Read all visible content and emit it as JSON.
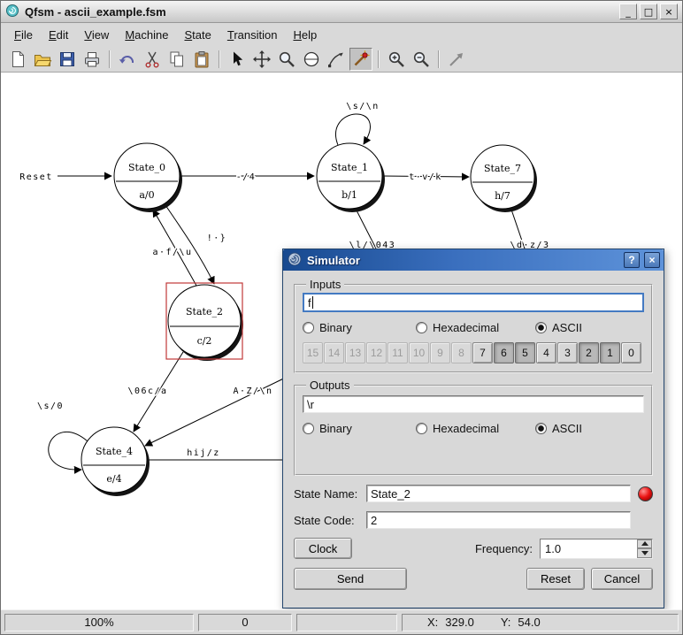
{
  "window": {
    "title": "Qfsm - ascii_example.fsm",
    "controls": {
      "minimize": "_",
      "maximize": "□",
      "close": "×"
    }
  },
  "menu": {
    "items": [
      "File",
      "Edit",
      "View",
      "Machine",
      "State",
      "Transition",
      "Help"
    ]
  },
  "toolbar": {
    "tools": [
      "new-file",
      "open-file",
      "save-file",
      "print",
      "undo",
      "cut",
      "copy",
      "paste",
      "select",
      "move",
      "zoom",
      "add-state",
      "add-transition",
      "simulate",
      "zoom-in",
      "zoom-out",
      "pan"
    ],
    "active_tool": "simulate"
  },
  "canvas": {
    "states": [
      {
        "name": "State_0",
        "code": "a/0"
      },
      {
        "name": "State_1",
        "code": "b/1"
      },
      {
        "name": "State_7",
        "code": "h/7"
      },
      {
        "name": "State_2",
        "code": "c/2",
        "selected": true
      },
      {
        "name": "State_4",
        "code": "e/4"
      }
    ],
    "transitions": {
      "reset": "Reset",
      "t0_t1": "-/4",
      "t1_self": "\\s/\\n",
      "t1_t7": "t·v/k",
      "t0_t2": "!·}",
      "t2_t0": "a·f/\\u",
      "t1_down": "\\l/\\043",
      "t7_down": "\\d·z/3",
      "t2_t4": "\\06c/a",
      "az_t4": "A·Z/\\n",
      "t4_self": "\\s/0",
      "t4_right": "hij/z"
    }
  },
  "simulator": {
    "title": "Simulator",
    "help_glyph": "?",
    "close_glyph": "×",
    "inputs": {
      "legend": "Inputs",
      "value": "f",
      "modes": [
        "Binary",
        "Hexadecimal",
        "ASCII"
      ],
      "selected_mode": "ASCII",
      "bits": [
        {
          "label": "15",
          "state": "disabled"
        },
        {
          "label": "14",
          "state": "disabled"
        },
        {
          "label": "13",
          "state": "disabled"
        },
        {
          "label": "12",
          "state": "disabled"
        },
        {
          "label": "11",
          "state": "disabled"
        },
        {
          "label": "10",
          "state": "disabled"
        },
        {
          "label": "9",
          "state": "disabled"
        },
        {
          "label": "8",
          "state": "disabled"
        },
        {
          "label": "7",
          "state": "off"
        },
        {
          "label": "6",
          "state": "on"
        },
        {
          "label": "5",
          "state": "on"
        },
        {
          "label": "4",
          "state": "off"
        },
        {
          "label": "3",
          "state": "off"
        },
        {
          "label": "2",
          "state": "on"
        },
        {
          "label": "1",
          "state": "on"
        },
        {
          "label": "0",
          "state": "off"
        }
      ]
    },
    "outputs": {
      "legend": "Outputs",
      "value": "\\r",
      "modes": [
        "Binary",
        "Hexadecimal",
        "ASCII"
      ],
      "selected_mode": "ASCII"
    },
    "state_name_label": "State Name:",
    "state_name": "State_2",
    "state_code_label": "State Code:",
    "state_code": "2",
    "clock_button": "Clock",
    "frequency_label": "Frequency:",
    "frequency_value": "1.0",
    "send_button": "Send",
    "reset_button": "Reset",
    "cancel_button": "Cancel"
  },
  "statusbar": {
    "zoom": "100%",
    "value": "0",
    "x_label": "X:",
    "x": "329.0",
    "y_label": "Y:",
    "y": "54.0"
  }
}
